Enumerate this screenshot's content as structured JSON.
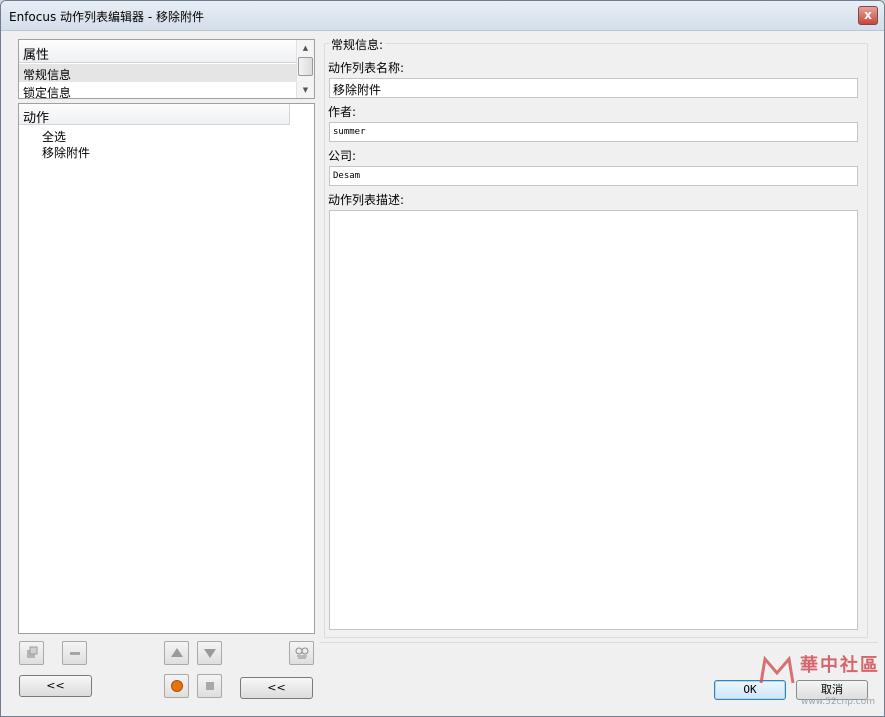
{
  "window": {
    "title": "Enfocus 动作列表编辑器 - 移除附件",
    "close_label": "x"
  },
  "properties": {
    "header": "属性",
    "items": [
      "常规信息",
      "锁定信息"
    ],
    "selected_index": 0
  },
  "actions": {
    "header": "动作",
    "items": [
      "全选",
      "移除附件"
    ]
  },
  "toolbar": {
    "collapse_label_left": "<<",
    "collapse_label_right": "<<"
  },
  "general": {
    "group_label": "常规信息:",
    "name_label": "动作列表名称:",
    "name_value": "移除附件",
    "author_label": "作者:",
    "author_value": "summer",
    "company_label": "公司:",
    "company_value": "Desam",
    "desc_label": "动作列表描述:",
    "desc_value": ""
  },
  "buttons": {
    "ok": "OK",
    "cancel": "取消"
  },
  "watermark": {
    "text": "華中社區",
    "url": "www.52cnp.com"
  },
  "colors": {
    "record_dot": "#e8720c",
    "accent_border": "#3c7fb1",
    "watermark": "#d24f54"
  }
}
